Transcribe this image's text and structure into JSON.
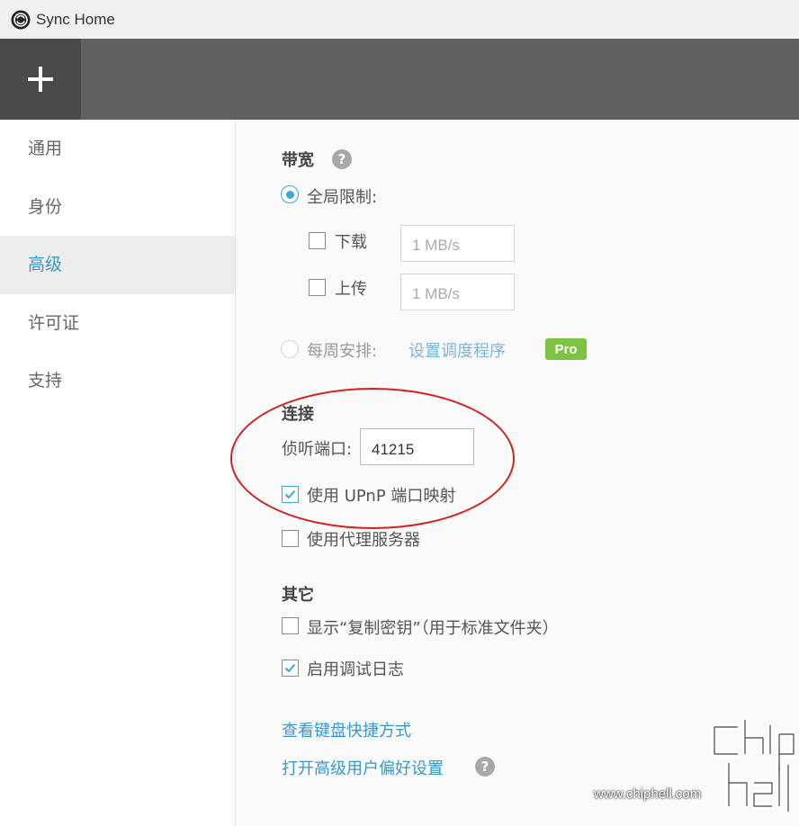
{
  "window": {
    "title": "Sync Home"
  },
  "toolbar": {
    "add_label": "+"
  },
  "sidebar": {
    "items": [
      {
        "label": "通用"
      },
      {
        "label": "身份"
      },
      {
        "label": "高级"
      },
      {
        "label": "许可证"
      },
      {
        "label": "支持"
      }
    ],
    "active": "高级"
  },
  "bandwidth": {
    "title": "带宽",
    "help": "?",
    "global_limit_label": "全局限制:",
    "global_limit_selected": true,
    "download_label": "下载",
    "download_checked": false,
    "download_placeholder": "1 MB/s",
    "upload_label": "上传",
    "upload_checked": false,
    "upload_placeholder": "1 MB/s",
    "schedule_label": "每周安排:",
    "schedule_selected": false,
    "schedule_link": "设置调度程序",
    "pro_badge": "Pro"
  },
  "connection": {
    "title": "连接",
    "port_label": "侦听端口:",
    "port_value": "41215",
    "upnp_label": "使用 UPnP 端口映射",
    "upnp_checked": true,
    "proxy_label": "使用代理服务器",
    "proxy_checked": false
  },
  "other": {
    "title": "其它",
    "copy_key_label": "显示“复制密钥”（用于标准文件夹）",
    "copy_key_checked": false,
    "debug_log_label": "启用调试日志",
    "debug_log_checked": true
  },
  "links": {
    "shortcuts": "查看键盘快捷方式",
    "power_user": "打开高级用户偏好设置",
    "power_user_help": "?"
  },
  "watermark": {
    "text": "www.chiphell.com"
  },
  "colors": {
    "accent": "#39a9d6",
    "link": "#3a97c9",
    "pro": "#7ec241",
    "annotation": "#d42020",
    "toolbar": "#616161"
  }
}
